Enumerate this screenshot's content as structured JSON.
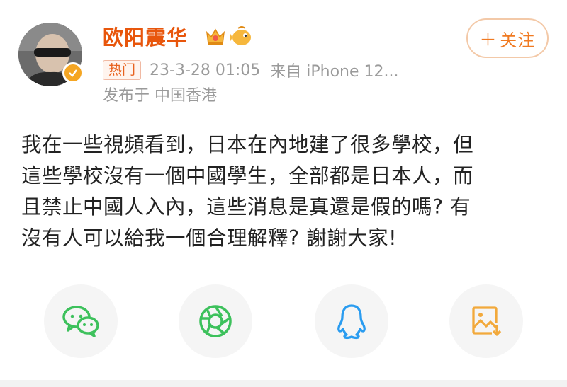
{
  "post": {
    "username": "欧阳震华",
    "badges": [
      "crown-badge-icon",
      "fish-badge-icon"
    ],
    "verified": true,
    "follow_label": "关注",
    "follow_plus": "+",
    "hot_tag": "热门",
    "timestamp": "23-3-28 01:05",
    "source": "来自 iPhone 12...",
    "location": "发布于 中国香港",
    "body_lines": [
      "我在一些視頻看到，日本在內地建了很多學校，但",
      "這些學校沒有一個中國學生，全部都是日本人，而",
      "且禁止中國人入內，這些消息是真還是假的嗎? 有",
      "沒有人可以給我一個合理解釋? 謝謝大家!"
    ]
  },
  "share": {
    "items": [
      "wechat-icon",
      "moments-icon",
      "qq-icon",
      "save-image-icon"
    ]
  },
  "colors": {
    "username": "#e8560c",
    "accent": "#f07a22",
    "meta": "#9a9a9a",
    "wechat": "#3dc15c",
    "qq": "#2a9cf0",
    "save": "#f2a93b"
  }
}
